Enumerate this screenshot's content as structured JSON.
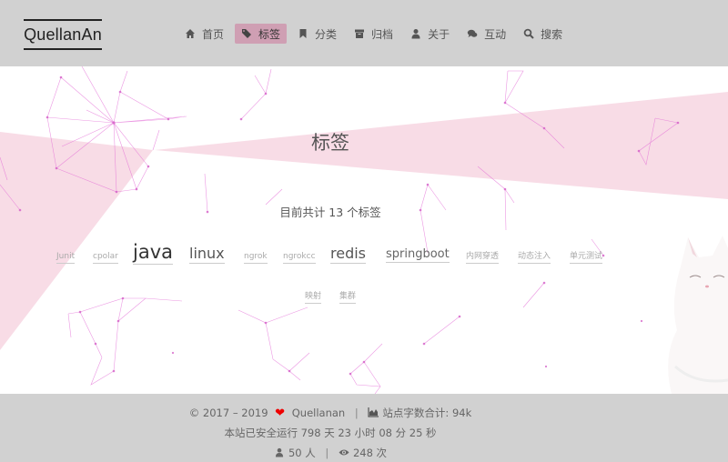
{
  "header": {
    "brand": "QuellanAn",
    "nav": [
      {
        "label": "首页",
        "icon": "home-icon",
        "active": false
      },
      {
        "label": "标签",
        "icon": "tags-icon",
        "active": true
      },
      {
        "label": "分类",
        "icon": "bookmark-icon",
        "active": false
      },
      {
        "label": "归档",
        "icon": "archive-icon",
        "active": false
      },
      {
        "label": "关于",
        "icon": "user-icon",
        "active": false
      },
      {
        "label": "互动",
        "icon": "comments-icon",
        "active": false
      },
      {
        "label": "搜索",
        "icon": "search-icon",
        "active": false
      }
    ]
  },
  "main": {
    "title": "标签",
    "summary": "目前共计 13 个标签",
    "tags": [
      "Junit",
      "cpolar",
      "java",
      "linux",
      "ngrok",
      "ngrokcc",
      "redis",
      "springboot",
      "内网穿透",
      "动态注入",
      "单元测试",
      "映射",
      "集群"
    ]
  },
  "footer": {
    "copyright": "© 2017 – 2019",
    "author": "Quellanan",
    "wordcount_label": "站点字数合计:",
    "wordcount_value": "94k",
    "runtime": "本站已安全运行 798 天 23 小时 08 分 25 秒",
    "visitors": "50 人",
    "views": "248 次"
  },
  "colors": {
    "header_bg": "#d1d1d1",
    "active_tab": "#cf9fb3",
    "ribbon": "#f7d6e2",
    "particle_lines": "#e36bd6",
    "heart": "#e00000"
  }
}
